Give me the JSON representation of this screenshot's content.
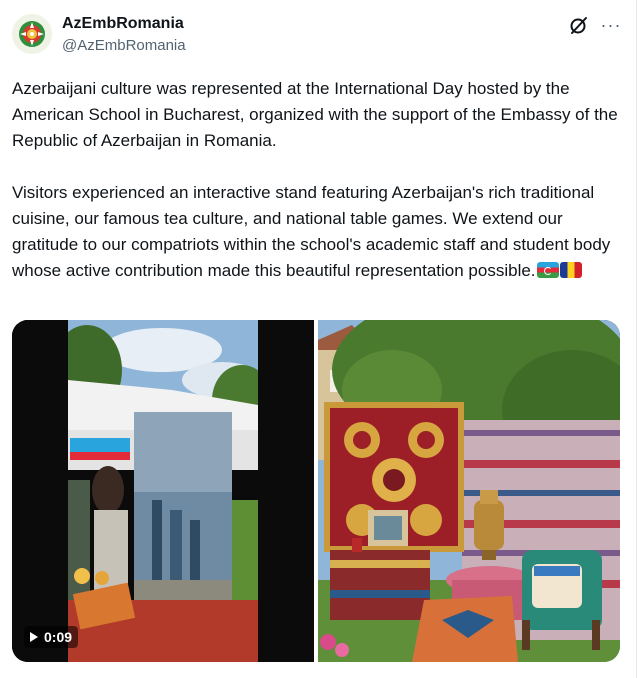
{
  "tweet": {
    "display_name": "AzEmbRomania",
    "handle": "@AzEmbRomania",
    "avatar_icon": "embassy-emblem-avatar",
    "grok_icon": "grok-icon",
    "more_label": "···",
    "text": "Azerbaijani culture was represented at the International Day hosted by the American School in Bucharest, organized with the support of the Embassy of the Republic of Azerbaijan in Romania.\n\nVisitors experienced an interactive stand featuring Azerbaijan's rich traditional cuisine, our famous tea culture, and national table games. We extend our gratitude to our compatriots within the school's academic staff and student body whose active contribution made this beautiful representation possible.",
    "emoji": [
      "flag-azerbaijan",
      "flag-romania"
    ],
    "media": {
      "video_duration": "0:09",
      "items": [
        "video",
        "photo"
      ]
    }
  },
  "colors": {
    "text": "#0f1419",
    "secondary": "#536471"
  }
}
